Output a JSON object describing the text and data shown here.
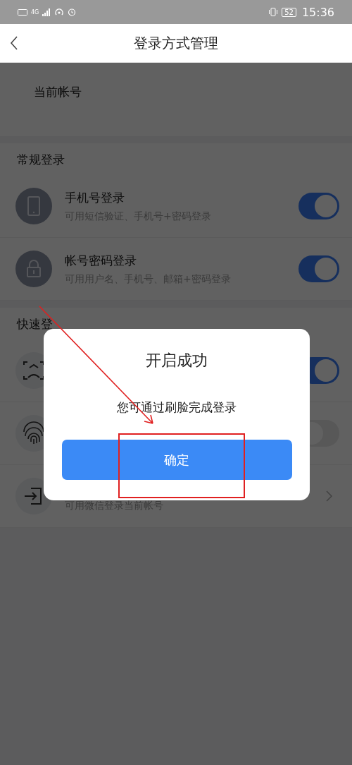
{
  "status_bar": {
    "network": "4G",
    "battery": "52",
    "time": "15:36"
  },
  "header": {
    "title": "登录方式管理"
  },
  "account": {
    "label": "当前帐号"
  },
  "sections": [
    {
      "label": "常规登录",
      "rows": [
        {
          "kind": "toggle",
          "title": "手机号登录",
          "subtitle": "可用短信验证、手机号+密码登录",
          "on": true
        },
        {
          "kind": "toggle",
          "title": "帐号密码登录",
          "subtitle": "可用用户名、手机号、邮箱+密码登录",
          "on": true
        }
      ]
    },
    {
      "label": "快速登",
      "rows": [
        {
          "kind": "toggle",
          "on": true
        },
        {
          "kind": "toggle",
          "on": false
        },
        {
          "kind": "link",
          "subtitle": "可用微信登录当前帐号"
        }
      ]
    }
  ],
  "dialog": {
    "title": "开启成功",
    "message": "您可通过刷脸完成登录",
    "button": "确定"
  },
  "annotations": [
    {
      "kind": "arrow"
    },
    {
      "kind": "box"
    }
  ]
}
